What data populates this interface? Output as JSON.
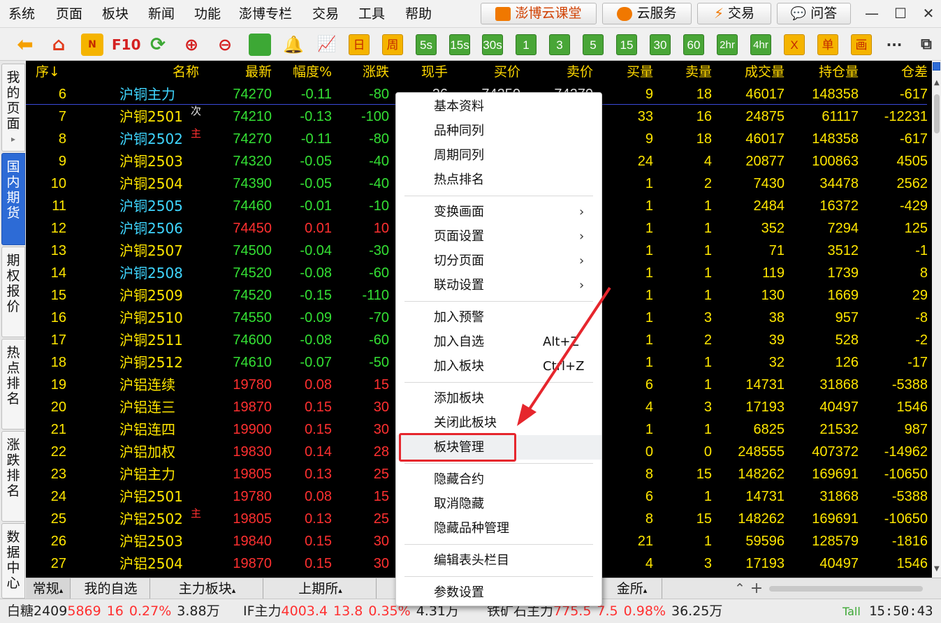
{
  "menu": [
    "系统",
    "页面",
    "板块",
    "新闻",
    "功能",
    "澎博专栏",
    "交易",
    "工具",
    "帮助"
  ],
  "top_buttons": [
    {
      "label": "澎博云课堂",
      "icon": "classroom-icon"
    },
    {
      "label": "云服务",
      "icon": "cloud-icon"
    },
    {
      "label": "交易",
      "icon": "lightning-icon"
    },
    {
      "label": "问答",
      "icon": "chat-icon"
    }
  ],
  "window_controls": {
    "minimize": "—",
    "maximize": "☐",
    "close": "✕"
  },
  "toolbar": {
    "f10": "F10",
    "periods": [
      "日",
      "周",
      "5s",
      "15s",
      "30s",
      "1",
      "3",
      "5",
      "15",
      "30",
      "60",
      "2hr",
      "4hr"
    ],
    "x_label": "X",
    "single": "单",
    "paint": "画",
    "more": "···"
  },
  "side_tabs": [
    "我的页面",
    "国内期货",
    "期权报价",
    "热点排名",
    "涨跌排名",
    "数据中心"
  ],
  "side_arrow": "▸",
  "columns": [
    "序↓",
    "名称",
    "最新",
    "幅度%",
    "涨跌",
    "现手",
    "买价",
    "卖价",
    "买量",
    "卖量",
    "成交量",
    "持仓量",
    "仓差"
  ],
  "first_row_hidden": {
    "hand": "26",
    "bid": "74250",
    "ask": "74270"
  },
  "rows": [
    {
      "no": "6",
      "name": "沪铜主力",
      "tag": "",
      "last": "74270",
      "pct": "-0.11",
      "chg": "-80",
      "bq": "9",
      "aq": "18",
      "vol": "46017",
      "oi": "148358",
      "diff": "-617",
      "dir": "down",
      "ncolor": "cy"
    },
    {
      "no": "7",
      "name": "沪铜2501",
      "tag": "次",
      "last": "74210",
      "pct": "-0.13",
      "chg": "-100",
      "bq": "33",
      "aq": "16",
      "vol": "24875",
      "oi": "61117",
      "diff": "-12231",
      "dir": "down",
      "ncolor": "y"
    },
    {
      "no": "8",
      "name": "沪铜2502",
      "tag": "主",
      "last": "74270",
      "pct": "-0.11",
      "chg": "-80",
      "bq": "9",
      "aq": "18",
      "vol": "46017",
      "oi": "148358",
      "diff": "-617",
      "dir": "down",
      "ncolor": "cy"
    },
    {
      "no": "9",
      "name": "沪铜2503",
      "tag": "",
      "last": "74320",
      "pct": "-0.05",
      "chg": "-40",
      "bq": "24",
      "aq": "4",
      "vol": "20877",
      "oi": "100863",
      "diff": "4505",
      "dir": "down",
      "ncolor": "y"
    },
    {
      "no": "10",
      "name": "沪铜2504",
      "tag": "",
      "last": "74390",
      "pct": "-0.05",
      "chg": "-40",
      "bq": "1",
      "aq": "2",
      "vol": "7430",
      "oi": "34478",
      "diff": "2562",
      "dir": "down",
      "ncolor": "y"
    },
    {
      "no": "11",
      "name": "沪铜2505",
      "tag": "",
      "last": "74460",
      "pct": "-0.01",
      "chg": "-10",
      "bq": "1",
      "aq": "1",
      "vol": "2484",
      "oi": "16372",
      "diff": "-429",
      "dir": "down",
      "ncolor": "cy"
    },
    {
      "no": "12",
      "name": "沪铜2506",
      "tag": "",
      "last": "74450",
      "pct": "0.01",
      "chg": "10",
      "bq": "1",
      "aq": "1",
      "vol": "352",
      "oi": "7294",
      "diff": "125",
      "dir": "up",
      "ncolor": "cy"
    },
    {
      "no": "13",
      "name": "沪铜2507",
      "tag": "",
      "last": "74500",
      "pct": "-0.04",
      "chg": "-30",
      "bq": "1",
      "aq": "1",
      "vol": "71",
      "oi": "3512",
      "diff": "-1",
      "dir": "down",
      "ncolor": "y"
    },
    {
      "no": "14",
      "name": "沪铜2508",
      "tag": "",
      "last": "74520",
      "pct": "-0.08",
      "chg": "-60",
      "bq": "1",
      "aq": "1",
      "vol": "119",
      "oi": "1739",
      "diff": "8",
      "dir": "down",
      "ncolor": "cy"
    },
    {
      "no": "15",
      "name": "沪铜2509",
      "tag": "",
      "last": "74520",
      "pct": "-0.15",
      "chg": "-110",
      "bq": "1",
      "aq": "1",
      "vol": "130",
      "oi": "1669",
      "diff": "29",
      "dir": "down",
      "ncolor": "y"
    },
    {
      "no": "16",
      "name": "沪铜2510",
      "tag": "",
      "last": "74550",
      "pct": "-0.09",
      "chg": "-70",
      "bq": "1",
      "aq": "3",
      "vol": "38",
      "oi": "957",
      "diff": "-8",
      "dir": "down",
      "ncolor": "y"
    },
    {
      "no": "17",
      "name": "沪铜2511",
      "tag": "",
      "last": "74600",
      "pct": "-0.08",
      "chg": "-60",
      "bq": "1",
      "aq": "2",
      "vol": "39",
      "oi": "528",
      "diff": "-2",
      "dir": "down",
      "ncolor": "y"
    },
    {
      "no": "18",
      "name": "沪铜2512",
      "tag": "",
      "last": "74610",
      "pct": "-0.07",
      "chg": "-50",
      "bq": "1",
      "aq": "1",
      "vol": "32",
      "oi": "126",
      "diff": "-17",
      "dir": "down",
      "ncolor": "y"
    },
    {
      "no": "19",
      "name": "沪铝连续",
      "tag": "",
      "last": "19780",
      "pct": "0.08",
      "chg": "15",
      "bq": "6",
      "aq": "1",
      "vol": "14731",
      "oi": "31868",
      "diff": "-5388",
      "dir": "up",
      "ncolor": "y"
    },
    {
      "no": "20",
      "name": "沪铝连三",
      "tag": "",
      "last": "19870",
      "pct": "0.15",
      "chg": "30",
      "bq": "4",
      "aq": "3",
      "vol": "17193",
      "oi": "40497",
      "diff": "1546",
      "dir": "up",
      "ncolor": "y"
    },
    {
      "no": "21",
      "name": "沪铝连四",
      "tag": "",
      "last": "19900",
      "pct": "0.15",
      "chg": "30",
      "bq": "1",
      "aq": "1",
      "vol": "6825",
      "oi": "21532",
      "diff": "987",
      "dir": "up",
      "ncolor": "y"
    },
    {
      "no": "22",
      "name": "沪铝加权",
      "tag": "",
      "last": "19830",
      "pct": "0.14",
      "chg": "28",
      "bq": "0",
      "aq": "0",
      "vol": "248555",
      "oi": "407372",
      "diff": "-14962",
      "dir": "up",
      "ncolor": "y"
    },
    {
      "no": "23",
      "name": "沪铝主力",
      "tag": "",
      "last": "19805",
      "pct": "0.13",
      "chg": "25",
      "bq": "8",
      "aq": "15",
      "vol": "148262",
      "oi": "169691",
      "diff": "-10650",
      "dir": "up",
      "ncolor": "y"
    },
    {
      "no": "24",
      "name": "沪铝2501",
      "tag": "",
      "last": "19780",
      "pct": "0.08",
      "chg": "15",
      "bq": "6",
      "aq": "1",
      "vol": "14731",
      "oi": "31868",
      "diff": "-5388",
      "dir": "up",
      "ncolor": "y"
    },
    {
      "no": "25",
      "name": "沪铝2502",
      "tag": "主",
      "last": "19805",
      "pct": "0.13",
      "chg": "25",
      "bq": "8",
      "aq": "15",
      "vol": "148262",
      "oi": "169691",
      "diff": "-10650",
      "dir": "up",
      "ncolor": "y"
    },
    {
      "no": "26",
      "name": "沪铝2503",
      "tag": "",
      "last": "19840",
      "pct": "0.15",
      "chg": "30",
      "bq": "21",
      "aq": "1",
      "vol": "59596",
      "oi": "128579",
      "diff": "-1816",
      "dir": "up",
      "ncolor": "y"
    },
    {
      "no": "27",
      "name": "沪铝2504",
      "tag": "",
      "last": "19870",
      "pct": "0.15",
      "chg": "30",
      "bq": "4",
      "aq": "3",
      "vol": "17193",
      "oi": "40497",
      "diff": "1546",
      "dir": "up",
      "ncolor": "y"
    }
  ],
  "bottom_tabs": [
    "常规",
    "我的自选",
    "主力板块",
    "上期所",
    "金所"
  ],
  "bottom_tab_arrow": "▴",
  "bottom_controls": {
    "updown": "⌃",
    "add": "+"
  },
  "status": [
    {
      "name": "白糖2409",
      "last": "5869",
      "chg": "16",
      "pct": "0.27%",
      "amt": "3.88万"
    },
    {
      "name": "IF主力",
      "last": "4003.4",
      "chg": "13.8",
      "pct": "0.35%",
      "amt": "4.31万"
    },
    {
      "name": "铁矿石主力",
      "last": "775.5",
      "chg": "7.5",
      "pct": "0.98%",
      "amt": "36.25万"
    }
  ],
  "signal": "Tall",
  "clock": "15:50:43",
  "context_menu": {
    "groups": [
      [
        {
          "label": "基本资料"
        },
        {
          "label": "品种同列"
        },
        {
          "label": "周期同列"
        },
        {
          "label": "热点排名"
        }
      ],
      [
        {
          "label": "变换画面",
          "sub": true
        },
        {
          "label": "页面设置",
          "sub": true
        },
        {
          "label": "切分页面",
          "sub": true
        },
        {
          "label": "联动设置",
          "sub": true
        }
      ],
      [
        {
          "label": "加入预警"
        },
        {
          "label": "加入自选",
          "shortcut": "Alt+Z"
        },
        {
          "label": "加入板块",
          "shortcut": "Ctrl+Z"
        }
      ],
      [
        {
          "label": "添加板块"
        },
        {
          "label": "关闭此板块"
        },
        {
          "label": "板块管理",
          "highlight": true
        }
      ],
      [
        {
          "label": "隐藏合约"
        },
        {
          "label": "取消隐藏"
        },
        {
          "label": "隐藏品种管理"
        }
      ],
      [
        {
          "label": "编辑表头栏目"
        }
      ],
      [
        {
          "label": "参数设置"
        }
      ]
    ],
    "arrow_glyph": "›"
  },
  "colors": {
    "up": "#ff3030",
    "down": "#34e034",
    "accent": "#ffe600",
    "cyan": "#3fd6ff",
    "highlight_box": "#e6262d"
  }
}
